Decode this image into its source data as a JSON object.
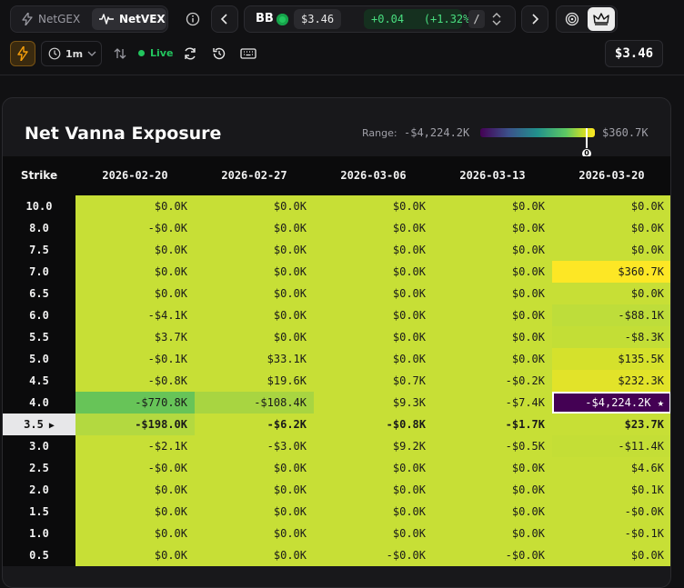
{
  "toolbar": {
    "tabs": [
      {
        "label": "NetGEX",
        "icon": "bolt-icon"
      },
      {
        "label": "NetVEX",
        "icon": "activity-icon"
      }
    ],
    "ticker": {
      "symbol": "BB",
      "price": "$3.46",
      "change": "+0.04",
      "change_pct": "(+1.32%)",
      "shortcut": "/"
    },
    "interval": "1m",
    "live_label": "Live",
    "last_price": "$3.46"
  },
  "panel": {
    "title": "Net Vanna Exposure",
    "range_label": "Range:",
    "range_min": "-$4,224.2K",
    "range_max": "$360.7K",
    "zero_marker": "0"
  },
  "table": {
    "strike_header": "Strike",
    "expirations": [
      "2026-02-20",
      "2026-02-27",
      "2026-03-06",
      "2026-03-13",
      "2026-03-20"
    ],
    "current_strike": "3.5",
    "rows": [
      {
        "strike": "10.0",
        "values": [
          "$0.0K",
          "$0.0K",
          "$0.0K",
          "$0.0K",
          "$0.0K"
        ]
      },
      {
        "strike": "8.0",
        "values": [
          "-$0.0K",
          "$0.0K",
          "$0.0K",
          "$0.0K",
          "$0.0K"
        ]
      },
      {
        "strike": "7.5",
        "values": [
          "$0.0K",
          "$0.0K",
          "$0.0K",
          "$0.0K",
          "$0.0K"
        ]
      },
      {
        "strike": "7.0",
        "values": [
          "$0.0K",
          "$0.0K",
          "$0.0K",
          "$0.0K",
          "$360.7K"
        ]
      },
      {
        "strike": "6.5",
        "values": [
          "$0.0K",
          "$0.0K",
          "$0.0K",
          "$0.0K",
          "$0.0K"
        ]
      },
      {
        "strike": "6.0",
        "values": [
          "-$4.1K",
          "$0.0K",
          "$0.0K",
          "$0.0K",
          "-$88.1K"
        ]
      },
      {
        "strike": "5.5",
        "values": [
          "$3.7K",
          "$0.0K",
          "$0.0K",
          "$0.0K",
          "-$8.3K"
        ]
      },
      {
        "strike": "5.0",
        "values": [
          "-$0.1K",
          "$33.1K",
          "$0.0K",
          "$0.0K",
          "$135.5K"
        ]
      },
      {
        "strike": "4.5",
        "values": [
          "-$0.8K",
          "$19.6K",
          "$0.7K",
          "-$0.2K",
          "$232.3K"
        ]
      },
      {
        "strike": "4.0",
        "values": [
          "-$770.8K",
          "-$108.4K",
          "$9.3K",
          "-$7.4K",
          "-$4,224.2K ★"
        ]
      },
      {
        "strike": "3.5",
        "values": [
          "-$198.0K",
          "-$6.2K",
          "-$0.8K",
          "-$1.7K",
          "$23.7K"
        ]
      },
      {
        "strike": "3.0",
        "values": [
          "-$2.1K",
          "-$3.0K",
          "$9.2K",
          "-$0.5K",
          "-$11.4K"
        ]
      },
      {
        "strike": "2.5",
        "values": [
          "-$0.0K",
          "$0.0K",
          "$0.0K",
          "$0.0K",
          "$4.6K"
        ]
      },
      {
        "strike": "2.0",
        "values": [
          "$0.0K",
          "$0.0K",
          "$0.0K",
          "$0.0K",
          "$0.1K"
        ]
      },
      {
        "strike": "1.5",
        "values": [
          "$0.0K",
          "$0.0K",
          "$0.0K",
          "$0.0K",
          "-$0.0K"
        ]
      },
      {
        "strike": "1.0",
        "values": [
          "$0.0K",
          "$0.0K",
          "$0.0K",
          "$0.0K",
          "-$0.1K"
        ]
      },
      {
        "strike": "0.5",
        "values": [
          "$0.0K",
          "$0.0K",
          "-$0.0K",
          "-$0.0K",
          "$0.0K"
        ]
      }
    ],
    "colors": {
      "base": "#c7df36",
      "special": {
        "3,4": "#fde725",
        "5,4": "#bedd3a",
        "6,4": "#c3de36",
        "7,4": "#d5e12c",
        "8,4": "#e2e329",
        "9,0": "#67c458",
        "9,1": "#a8d541",
        "9,4": "#440154",
        "10,0": "#b3d940",
        "11,4": "#c4de36"
      }
    }
  }
}
